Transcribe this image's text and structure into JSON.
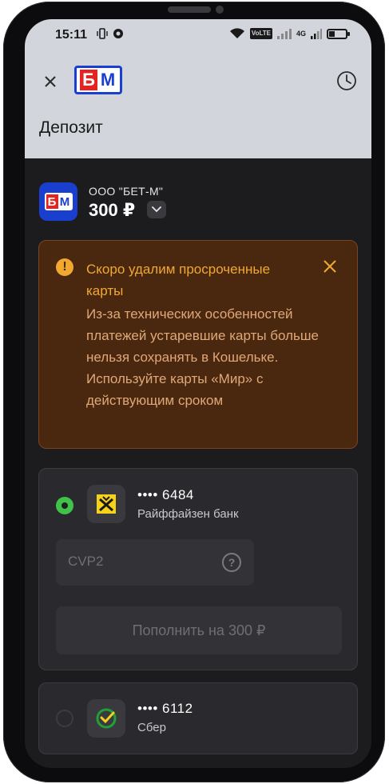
{
  "status_bar": {
    "time": "15:11",
    "network": "4G",
    "volte": "VoLTE"
  },
  "header": {
    "logo_text": "БМ",
    "title": "Депозит"
  },
  "merchant": {
    "name": "ООО \"БЕТ-М\"",
    "amount": "300 ₽"
  },
  "warning": {
    "title": "Скоро удалим просроченные карты",
    "body": "Из-за технических особенностей платежей устаревшие карты больше нельзя сохранять в Кошельке. Используйте карты «Мир» с действующим сроком",
    "icon": "exclamation-icon"
  },
  "cards": [
    {
      "number": "•••• 6484",
      "bank": "Райффайзен банк",
      "selected": true,
      "cvv_placeholder": "CVP2",
      "pay_label": "Пополнить на 300 ₽"
    },
    {
      "number": "•••• 6112",
      "bank": "Сбер",
      "selected": false
    }
  ],
  "colors": {
    "brand_blue": "#1a3fcf",
    "brand_red": "#e52421",
    "warning_bg": "#4a2810",
    "warning_accent": "#f0a830",
    "selected_green": "#3fc14a"
  }
}
